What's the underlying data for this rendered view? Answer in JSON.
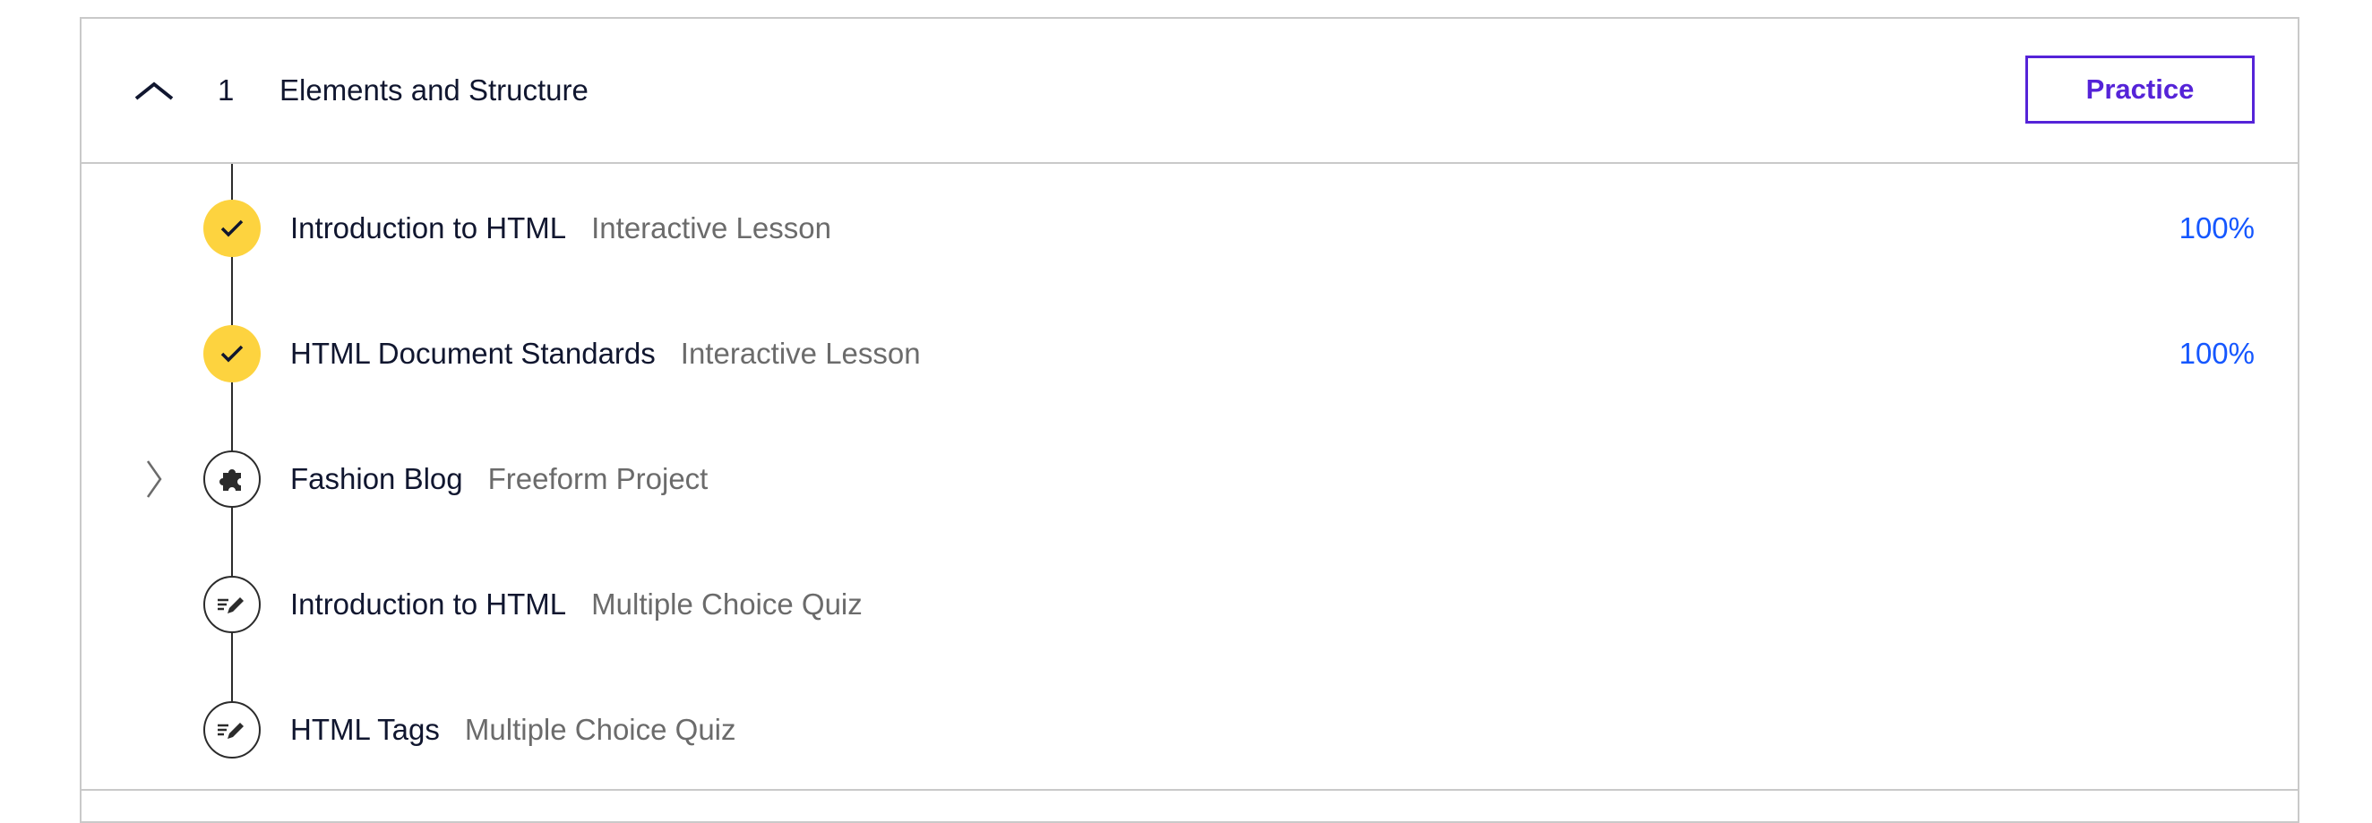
{
  "module": {
    "number": "1",
    "title": "Elements and Structure",
    "practice_label": "Practice",
    "collapse_icon": "chevron-up-icon"
  },
  "items": [
    {
      "title": "Introduction to HTML",
      "type": "Interactive Lesson",
      "progress": "100%",
      "status": "complete",
      "icon": "checkmark-icon"
    },
    {
      "title": "HTML Document Standards",
      "type": "Interactive Lesson",
      "progress": "100%",
      "status": "complete",
      "icon": "checkmark-icon"
    },
    {
      "title": "Fashion Blog",
      "type": "Freeform Project",
      "progress": "",
      "status": "incomplete",
      "icon": "puzzle-icon",
      "expandable": true
    },
    {
      "title": "Introduction to HTML",
      "type": "Multiple Choice Quiz",
      "progress": "",
      "status": "incomplete",
      "icon": "quiz-pencil-icon"
    },
    {
      "title": "HTML Tags",
      "type": "Multiple Choice Quiz",
      "progress": "",
      "status": "incomplete",
      "icon": "quiz-pencil-icon"
    }
  ],
  "colors": {
    "accent": "#5523d8",
    "complete": "#fdd33f",
    "progress_text": "#1557ff",
    "secondary_text": "#6b6b6b",
    "border": "#c9c9c9"
  }
}
